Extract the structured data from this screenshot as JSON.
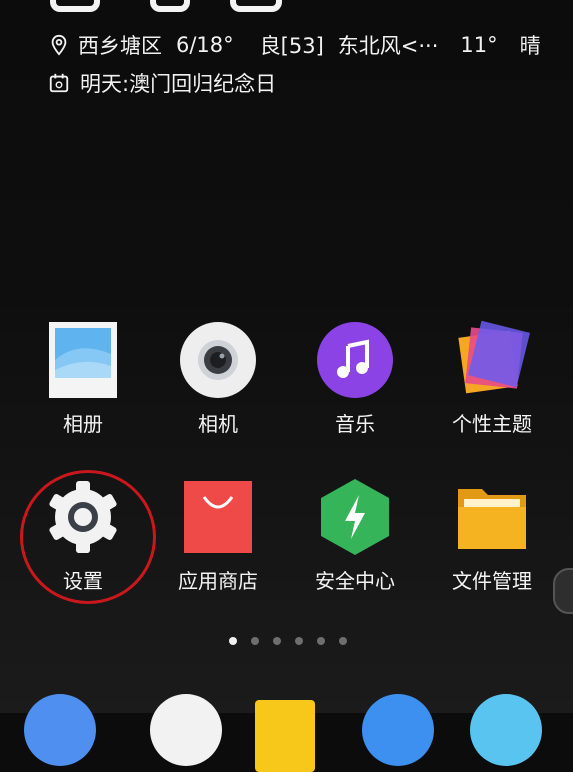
{
  "status": {
    "location": "西乡塘区",
    "temp_range": "6/18°",
    "air_quality": "良[53]",
    "wind": "东北风<···",
    "current_temp": "11°",
    "condition": "晴",
    "holiday": "明天:澳门回归纪念日"
  },
  "apps": [
    {
      "label": "相册",
      "icon": "gallery-icon"
    },
    {
      "label": "相机",
      "icon": "camera-icon"
    },
    {
      "label": "音乐",
      "icon": "music-icon"
    },
    {
      "label": "个性主题",
      "icon": "themes-icon"
    },
    {
      "label": "设置",
      "icon": "settings-gear-icon"
    },
    {
      "label": "应用商店",
      "icon": "app-store-bag-icon"
    },
    {
      "label": "安全中心",
      "icon": "security-shield-icon"
    },
    {
      "label": "文件管理",
      "icon": "folder-icon"
    }
  ],
  "pager": {
    "page_count": 6,
    "active_page": 1
  },
  "colors": {
    "highlight_ring": "#c9181d",
    "music": "#8b43e6",
    "store": "#ef4a48",
    "security": "#35b45a",
    "folder": "#f5b321"
  }
}
